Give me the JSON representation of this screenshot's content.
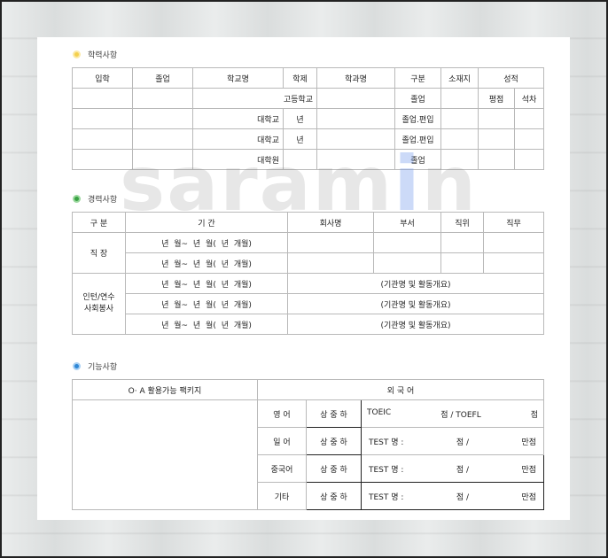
{
  "watermark": {
    "pre": "saram",
    "accent": "i",
    "post": "n"
  },
  "education": {
    "title": "학력사항",
    "headers": [
      "입학",
      "졸업",
      "학교명",
      "학제",
      "학과명",
      "구분",
      "소재지",
      "성적"
    ],
    "grade_sub": [
      "평점",
      "석차"
    ],
    "rows": [
      {
        "school": "고등학교",
        "system": "",
        "type": "졸업"
      },
      {
        "school": "대학교",
        "system": "년",
        "type": "졸업.편입"
      },
      {
        "school": "대학교",
        "system": "년",
        "type": "졸업.편입"
      },
      {
        "school": "대학원",
        "system": "",
        "type": "졸업"
      }
    ]
  },
  "career": {
    "title": "경력사항",
    "headers": [
      "구  분",
      "기    간",
      "회사명",
      "부서",
      "직위",
      "직무"
    ],
    "period_text": "년   월~   년   월( 년  개월)",
    "job_label": "직  장",
    "intern_label_1": "인턴/연수",
    "intern_label_2": "사회봉사",
    "intern_desc": "(기관명 및 활동개요)"
  },
  "skills": {
    "title": "기능사항",
    "oa_header": "O· A 활용가능 팩키지",
    "foreign_header": "외          국          어",
    "level": "상 중 하",
    "languages": [
      {
        "name": "영  어",
        "test": "TOEIC",
        "mid": "점  /  TOEFL",
        "end": "점"
      },
      {
        "name": "일  어",
        "test": "TEST 명 :",
        "mid": "점 /",
        "end": "만점"
      },
      {
        "name": "중국어",
        "test": "TEST 명 :",
        "mid": "점 /",
        "end": "만점"
      },
      {
        "name": "기타",
        "test": "TEST 명 :",
        "mid": "점 /",
        "end": "만점"
      }
    ]
  }
}
